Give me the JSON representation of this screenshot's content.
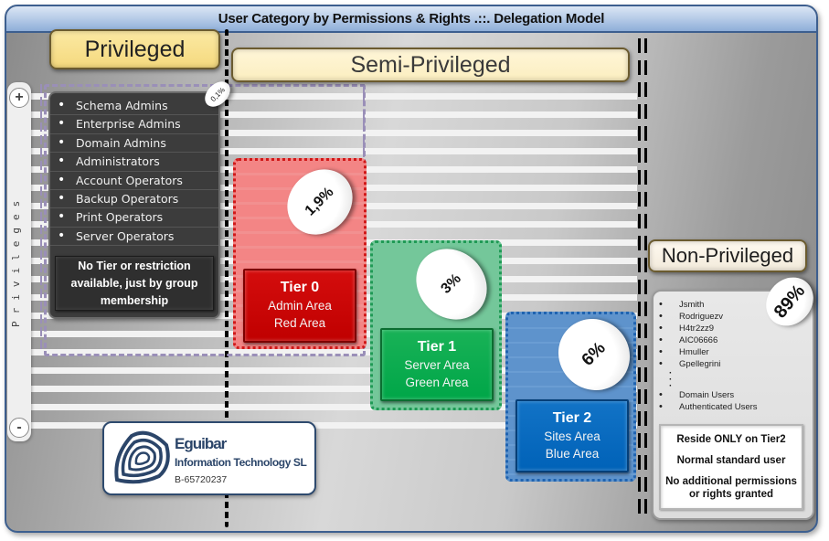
{
  "title": "User Category by Permissions & Rights .::. Delegation Model",
  "categories": {
    "privileged": "Privileged",
    "semi_privileged": "Semi-Privileged",
    "non_privileged": "Non-Privileged"
  },
  "zoom_control": {
    "plus_label": "+",
    "minus_label": "-",
    "axis_label": "Privileges"
  },
  "privileged": {
    "percentage": "0,1%",
    "groups": [
      "Schema Admins",
      "Enterprise Admins",
      "Domain Admins",
      "Administrators",
      "Account Operators",
      "Backup Operators",
      "Print Operators",
      "Server Operators"
    ],
    "note": "No Tier or restriction available, just by group membership"
  },
  "tiers": [
    {
      "title": "Tier 0",
      "line1": "Admin Area",
      "line2": "Red Area",
      "percentage": "1,9%",
      "color": "#c00000"
    },
    {
      "title": "Tier 1",
      "line1": "Server Area",
      "line2": "Green Area",
      "percentage": "3%",
      "color": "#00a648"
    },
    {
      "title": "Tier 2",
      "line1": "Sites Area",
      "line2": "Blue Area",
      "percentage": "6%",
      "color": "#0062b8"
    }
  ],
  "non_privileged": {
    "percentage": "89%",
    "users": [
      "Jsmith",
      "Rodriguezv",
      "H4tr2zz9",
      "AIC06666",
      "Hmuller",
      "Gpellegrini"
    ],
    "ellipsis": [
      "·",
      "·",
      "·"
    ],
    "groups": [
      "Domain Users",
      "Authenticated Users"
    ],
    "notes": [
      "Reside ONLY on Tier2",
      "Normal standard user",
      "No additional permissions or rights granted"
    ]
  },
  "logo": {
    "name": "Eguibar",
    "subtitle": "Information Technology SL",
    "id": "B-65720237"
  }
}
